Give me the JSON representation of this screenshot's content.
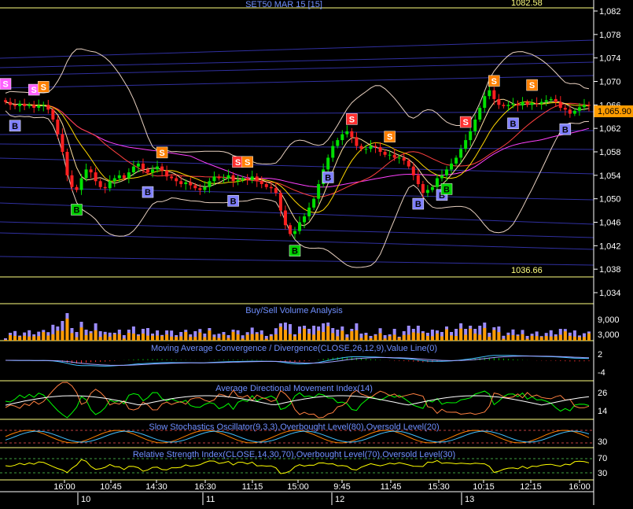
{
  "window": {
    "title": "SET50 MAR 15   [15]",
    "price_high_label": "1082.58",
    "price_low_label": "1036.66",
    "last_price_label": "1,065.90"
  },
  "colors": {
    "background": "#000000",
    "grid": "#2a2a6a",
    "axis_text": "#ffffff",
    "title_text": "#6f8fff",
    "up_candle": "#00e000",
    "down_candle": "#ff2020",
    "bollinger": "#e8d0c0",
    "ma_fast": "#ffd700",
    "ma_slow": "#ff40ff",
    "volume_buy": "#ff9c00",
    "volume_sell": "#9c8cff",
    "macd": "#40c0ff",
    "adx_plus": "#00ff00",
    "adx_minus": "#ff8040",
    "stoch": "#ff8000",
    "rsi": "#ffff00",
    "panel_border": "#ffff80",
    "price_badge": "#ff9c00"
  },
  "panels": {
    "price": {
      "y_ticks": [
        "1,082",
        "1,078",
        "1,074",
        "1,070",
        "1,066",
        "1,062",
        "1,058",
        "1,054",
        "1,050",
        "1,046",
        "1,042",
        "1,038",
        "1,034"
      ],
      "last_price": 1065.9,
      "high": 1082.58,
      "low": 1036.66
    },
    "volume": {
      "title": "Buy/Sell Volume Analysis",
      "y_ticks": [
        "9,000",
        "3,000"
      ]
    },
    "macd": {
      "title": "Moving Average Convergence / Divergence(CLOSE,26,12,9),Value Line(0)",
      "y_ticks": [
        "2",
        "-4"
      ]
    },
    "adx": {
      "title": "Average Directional Movement Index(14)",
      "y_ticks": [
        "26",
        "14"
      ]
    },
    "stoch": {
      "title": "Slow Stochastics Oscillator(9,3,3),Overbought Level(80),Oversold Level(20)",
      "y_ticks": [
        "30"
      ]
    },
    "rsi": {
      "title": "Relative Strength Index(CLOSE,14,30,70),Overbought Level(70),Oversold Level(30)",
      "y_ticks": [
        "70",
        "30"
      ]
    }
  },
  "x_axis": {
    "time_labels": [
      "16:00",
      "10:45",
      "14:30",
      "16:30",
      "11:15",
      "15:00",
      "9:45",
      "11:45",
      "15:30",
      "10:15",
      "12:15",
      "16:00"
    ],
    "date_labels": [
      "10",
      "11",
      "12",
      "13"
    ]
  },
  "signals": {
    "buy_label": "B",
    "sell_label": "S"
  },
  "chart_data": {
    "type": "candlestick",
    "title": "SET50 MAR 15   [15]",
    "y_range": [
      1034,
      1082.58
    ],
    "closes": [
      1066.5,
      1066.0,
      1065.8,
      1066.2,
      1065.8,
      1066.0,
      1065.5,
      1065.9,
      1066.0,
      1065.2,
      1063.5,
      1061.0,
      1058.0,
      1054.0,
      1052.0,
      1051.5,
      1053.5,
      1055.0,
      1054.5,
      1053.0,
      1052.0,
      1051.8,
      1053.0,
      1053.5,
      1054.0,
      1053.5,
      1054.5,
      1055.5,
      1056.0,
      1055.0,
      1054.5,
      1055.0,
      1055.5,
      1054.8,
      1053.8,
      1053.5,
      1053.0,
      1052.5,
      1052.8,
      1052.3,
      1051.8,
      1051.5,
      1052.0,
      1053.0,
      1053.8,
      1053.5,
      1053.5,
      1054.0,
      1053.0,
      1053.2,
      1053.5,
      1053.2,
      1053.8,
      1053.0,
      1052.5,
      1052.0,
      1051.8,
      1051.0,
      1048.0,
      1045.5,
      1044.0,
      1044.5,
      1046.0,
      1047.0,
      1048.5,
      1050.0,
      1052.5,
      1055.0,
      1057.0,
      1059.0,
      1060.0,
      1061.0,
      1061.5,
      1060.5,
      1059.0,
      1058.5,
      1058.5,
      1059.0,
      1058.8,
      1058.0,
      1057.5,
      1057.5,
      1057.0,
      1057.0,
      1056.5,
      1055.5,
      1054.0,
      1052.5,
      1051.0,
      1051.5,
      1052.0,
      1053.5,
      1054.0,
      1055.0,
      1056.0,
      1057.0,
      1058.5,
      1060.0,
      1061.5,
      1063.5,
      1065.5,
      1067.5,
      1068.5,
      1067.0,
      1066.0,
      1065.8,
      1066.0,
      1066.2,
      1065.9,
      1066.5,
      1066.0,
      1066.3,
      1066.2,
      1066.5,
      1066.8,
      1067.0,
      1066.5,
      1065.5,
      1065.2,
      1064.5,
      1065.0,
      1065.6,
      1066.0,
      1065.9
    ],
    "buy_signals_idx": [
      2,
      15,
      30,
      48,
      61,
      68,
      87,
      92,
      93,
      107,
      118
    ],
    "sell_signals_idx": [
      0,
      6,
      8,
      33,
      49,
      51,
      73,
      81,
      97,
      103,
      111
    ],
    "volume_y_ticks": [
      9000,
      3000
    ],
    "rsi_levels": {
      "overbought": 70,
      "oversold": 30
    },
    "stoch_levels": {
      "overbought": 80,
      "oversold": 20
    },
    "price_high": 1082.58,
    "price_low": 1036.66,
    "last_price": 1065.9
  }
}
